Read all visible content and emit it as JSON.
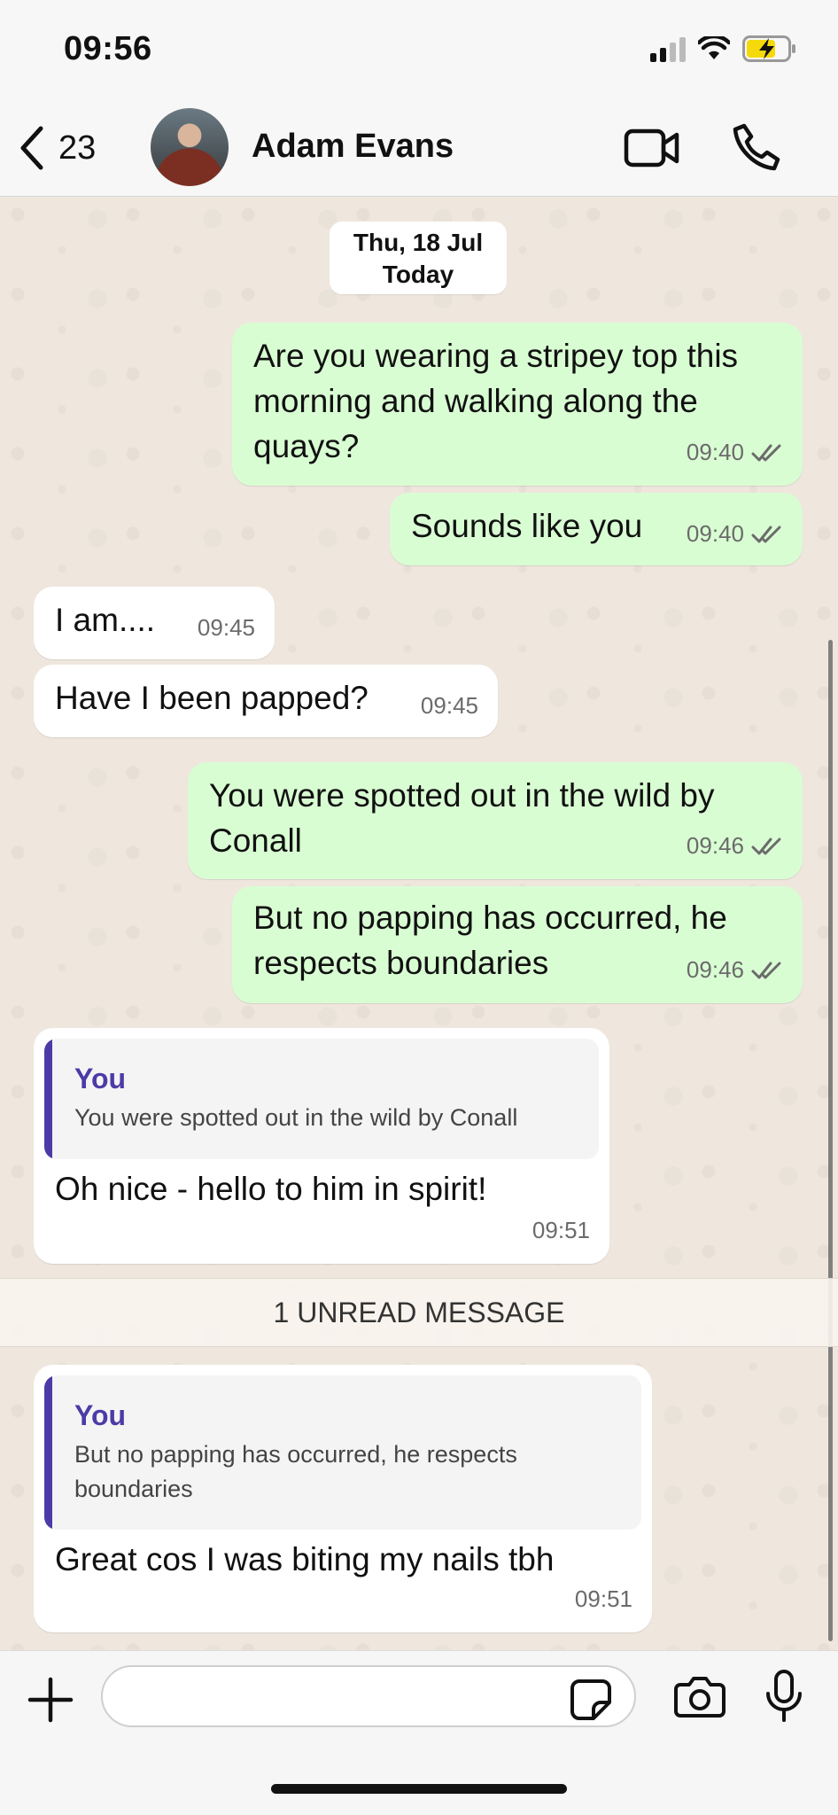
{
  "status_bar": {
    "time": "09:56",
    "icons": [
      "signal-icon",
      "wifi-icon",
      "battery-charging-icon"
    ],
    "battery_color": "#f5d90a"
  },
  "header": {
    "back_count": "23",
    "contact_name": "Adam Evans",
    "icons": [
      "chevron-left-icon",
      "video-call-icon",
      "phone-icon"
    ]
  },
  "chat": {
    "date_line1": "Thu, 18 Jul",
    "date_line2": "Today",
    "messages": [
      {
        "direction": "out",
        "lines": [
          "Are you wearing a stripey top this",
          "morning and walking along the",
          "quays?"
        ],
        "time": "09:40",
        "read": true
      },
      {
        "direction": "out",
        "lines": [
          "Sounds like you"
        ],
        "time": "09:40",
        "read": true
      },
      {
        "direction": "in",
        "lines": [
          "I am...."
        ],
        "time": "09:45"
      },
      {
        "direction": "in",
        "lines": [
          "Have I been papped?"
        ],
        "time": "09:45"
      },
      {
        "direction": "out",
        "lines": [
          "You were spotted out in the wild by",
          "Conall"
        ],
        "time": "09:46",
        "read": true
      },
      {
        "direction": "out",
        "lines": [
          "But no papping has occurred, he",
          "respects boundaries"
        ],
        "time": "09:46",
        "read": true
      },
      {
        "direction": "in",
        "quote": {
          "author": "You",
          "lines": [
            "You were spotted out in the wild by Conall"
          ]
        },
        "lines": [
          "Oh nice - hello to him in spirit!"
        ],
        "time": "09:51"
      },
      {
        "direction": "in",
        "quote": {
          "author": "You",
          "lines": [
            "But no papping has occurred, he respects",
            "boundaries"
          ]
        },
        "lines": [
          "Great cos I was biting my nails tbh"
        ],
        "time": "09:51"
      }
    ],
    "unread_label": "1 UNREAD MESSAGE",
    "colors": {
      "outgoing": "#d9fdd3",
      "incoming": "#ffffff",
      "quote_accent": "#4b3ba7",
      "read_tick": "#6b6b6b"
    }
  },
  "composer": {
    "input_value": "",
    "icons": [
      "plus-icon",
      "sticker-icon",
      "camera-icon",
      "microphone-icon"
    ]
  }
}
